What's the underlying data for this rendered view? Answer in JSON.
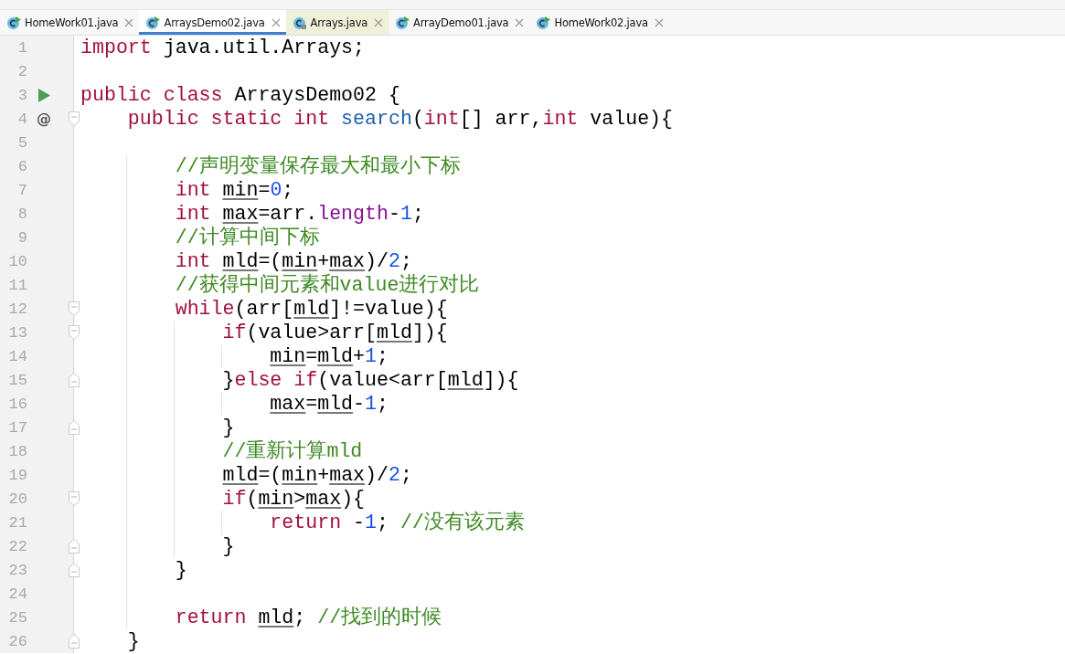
{
  "tabs": [
    {
      "label": "HomeWork01.java",
      "selected": false,
      "library": false
    },
    {
      "label": "ArraysDemo02.java",
      "selected": true,
      "library": false
    },
    {
      "label": "Arrays.java",
      "selected": false,
      "library": true
    },
    {
      "label": "ArrayDemo01.java",
      "selected": false,
      "library": false
    },
    {
      "label": "HomeWork02.java",
      "selected": false,
      "library": false
    }
  ],
  "editor": {
    "lines": [
      {
        "number": "1",
        "tokens": [
          {
            "kind": "keyword",
            "text": "import"
          },
          {
            "kind": "plain",
            "text": " java.util.Arrays;"
          }
        ]
      },
      {
        "number": "2"
      },
      {
        "number": "3",
        "marker": {
          "kind": "run"
        },
        "tokens": [
          {
            "kind": "keyword",
            "text": "public class"
          },
          {
            "kind": "plain",
            "text": " ArraysDemo02 {"
          }
        ]
      },
      {
        "number": "4",
        "marker": {
          "kind": "override",
          "text": "@"
        },
        "fold_open": true,
        "tokens": [
          {
            "kind": "keyword",
            "text": "    public static int "
          },
          {
            "kind": "method",
            "text": "search"
          },
          {
            "kind": "plain",
            "text": "("
          },
          {
            "kind": "keyword",
            "text": "int"
          },
          {
            "kind": "plain",
            "text": "[] arr,"
          },
          {
            "kind": "keyword",
            "text": "int"
          },
          {
            "kind": "plain",
            "text": " value){"
          }
        ]
      },
      {
        "number": "5"
      },
      {
        "number": "6",
        "tokens": [
          {
            "kind": "comment",
            "text": "        //声明变量保存最大和最小下标"
          }
        ]
      },
      {
        "number": "7",
        "tokens": [
          {
            "kind": "keyword",
            "text": "        int "
          },
          {
            "kind": "variable",
            "text": "min"
          },
          {
            "kind": "plain",
            "text": "="
          },
          {
            "kind": "number",
            "text": "0"
          },
          {
            "kind": "plain",
            "text": ";"
          }
        ]
      },
      {
        "number": "8",
        "tokens": [
          {
            "kind": "keyword",
            "text": "        int "
          },
          {
            "kind": "variable",
            "text": "max"
          },
          {
            "kind": "plain",
            "text": "=arr."
          },
          {
            "kind": "field",
            "text": "length"
          },
          {
            "kind": "plain",
            "text": "-"
          },
          {
            "kind": "number",
            "text": "1"
          },
          {
            "kind": "plain",
            "text": ";"
          }
        ]
      },
      {
        "number": "9",
        "tokens": [
          {
            "kind": "comment",
            "text": "        //计算中间下标"
          }
        ]
      },
      {
        "number": "10",
        "tokens": [
          {
            "kind": "keyword",
            "text": "        int "
          },
          {
            "kind": "variable",
            "text": "mld"
          },
          {
            "kind": "plain",
            "text": "=("
          },
          {
            "kind": "variable",
            "text": "min"
          },
          {
            "kind": "plain",
            "text": "+"
          },
          {
            "kind": "variable",
            "text": "max"
          },
          {
            "kind": "plain",
            "text": ")/"
          },
          {
            "kind": "number",
            "text": "2"
          },
          {
            "kind": "plain",
            "text": ";"
          }
        ]
      },
      {
        "number": "11",
        "tokens": [
          {
            "kind": "comment",
            "text": "        //获得中间元素和value进行对比"
          }
        ]
      },
      {
        "number": "12",
        "fold_open": true,
        "tokens": [
          {
            "kind": "keyword",
            "text": "        while"
          },
          {
            "kind": "plain",
            "text": "(arr["
          },
          {
            "kind": "variable",
            "text": "mld"
          },
          {
            "kind": "plain",
            "text": "]!=value){"
          }
        ]
      },
      {
        "number": "13",
        "fold_open": true,
        "tokens": [
          {
            "kind": "keyword",
            "text": "            if"
          },
          {
            "kind": "plain",
            "text": "(value>arr["
          },
          {
            "kind": "variable",
            "text": "mld"
          },
          {
            "kind": "plain",
            "text": "]){"
          }
        ]
      },
      {
        "number": "14",
        "tokens": [
          {
            "kind": "variable",
            "text": "                min"
          },
          {
            "kind": "plain",
            "text": "="
          },
          {
            "kind": "variable",
            "text": "mld"
          },
          {
            "kind": "plain",
            "text": "+"
          },
          {
            "kind": "number",
            "text": "1"
          },
          {
            "kind": "plain",
            "text": ";"
          }
        ]
      },
      {
        "number": "15",
        "fold_close": true,
        "tokens": [
          {
            "kind": "plain",
            "text": "            }"
          },
          {
            "kind": "keyword",
            "text": "else if"
          },
          {
            "kind": "plain",
            "text": "(value<arr["
          },
          {
            "kind": "variable",
            "text": "mld"
          },
          {
            "kind": "plain",
            "text": "]){"
          }
        ]
      },
      {
        "number": "16",
        "tokens": [
          {
            "kind": "variable",
            "text": "                max"
          },
          {
            "kind": "plain",
            "text": "="
          },
          {
            "kind": "variable",
            "text": "mld"
          },
          {
            "kind": "plain",
            "text": "-"
          },
          {
            "kind": "number",
            "text": "1"
          },
          {
            "kind": "plain",
            "text": ";"
          }
        ]
      },
      {
        "number": "17",
        "fold_close": true,
        "tokens": [
          {
            "kind": "plain",
            "text": "            }"
          }
        ]
      },
      {
        "number": "18",
        "tokens": [
          {
            "kind": "comment",
            "text": "            //重新计算mld"
          }
        ]
      },
      {
        "number": "19",
        "tokens": [
          {
            "kind": "variable",
            "text": "            mld"
          },
          {
            "kind": "plain",
            "text": "=("
          },
          {
            "kind": "variable",
            "text": "min"
          },
          {
            "kind": "plain",
            "text": "+"
          },
          {
            "kind": "variable",
            "text": "max"
          },
          {
            "kind": "plain",
            "text": ")/"
          },
          {
            "kind": "number",
            "text": "2"
          },
          {
            "kind": "plain",
            "text": ";"
          }
        ]
      },
      {
        "number": "20",
        "fold_open": true,
        "tokens": [
          {
            "kind": "keyword",
            "text": "            if"
          },
          {
            "kind": "plain",
            "text": "("
          },
          {
            "kind": "variable",
            "text": "min"
          },
          {
            "kind": "plain",
            "text": ">"
          },
          {
            "kind": "variable",
            "text": "max"
          },
          {
            "kind": "plain",
            "text": "){"
          }
        ]
      },
      {
        "number": "21",
        "tokens": [
          {
            "kind": "keyword",
            "text": "                return"
          },
          {
            "kind": "plain",
            "text": " -"
          },
          {
            "kind": "number",
            "text": "1"
          },
          {
            "kind": "plain",
            "text": "; "
          },
          {
            "kind": "comment",
            "text": "//没有该元素"
          }
        ]
      },
      {
        "number": "22",
        "fold_close": true,
        "tokens": [
          {
            "kind": "plain",
            "text": "            }"
          }
        ]
      },
      {
        "number": "23",
        "fold_close": true,
        "tokens": [
          {
            "kind": "plain",
            "text": "        }"
          }
        ]
      },
      {
        "number": "24"
      },
      {
        "number": "25",
        "tokens": [
          {
            "kind": "keyword",
            "text": "        return "
          },
          {
            "kind": "variable",
            "text": "mld"
          },
          {
            "kind": "plain",
            "text": "; "
          },
          {
            "kind": "comment",
            "text": "//找到的时候"
          }
        ]
      },
      {
        "number": "26",
        "fold_close": true,
        "tokens": [
          {
            "kind": "plain",
            "text": "    }"
          }
        ]
      }
    ]
  }
}
